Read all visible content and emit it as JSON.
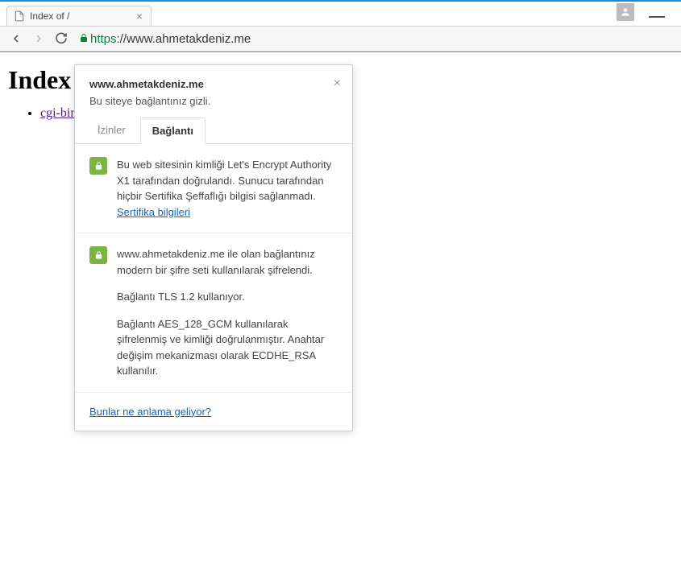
{
  "tab": {
    "title": "Index of /"
  },
  "url": {
    "protocol": "https",
    "rest": "://www.ahmetakdeniz.me"
  },
  "page": {
    "heading": "Index of /",
    "link": "cgi-bin/"
  },
  "popup": {
    "site": "www.ahmetakdeniz.me",
    "subtitle": "Bu siteye bağlantınız gizli.",
    "tabs": {
      "permissions": "İzinler",
      "connection": "Bağlantı"
    },
    "section1": {
      "text": "Bu web sitesinin kimliği Let's Encrypt Authority X1 tarafından doğrulandı. Sunucu tarafından hiçbir Sertifika Şeffaflığı bilgisi sağlanmadı.",
      "link": "Sertifika bilgileri"
    },
    "section2": {
      "p1": "www.ahmetakdeniz.me ile olan bağlantınız modern bir şifre seti kullanılarak şifrelendi.",
      "p2": "Bağlantı TLS 1.2 kullanıyor.",
      "p3": "Bağlantı AES_128_GCM kullanılarak şifrelenmiş ve kimliği doğrulanmıştır. Anahtar değişim mekanizması olarak ECDHE_RSA kullanılır."
    },
    "footer_link": "Bunlar ne anlama geliyor?"
  }
}
